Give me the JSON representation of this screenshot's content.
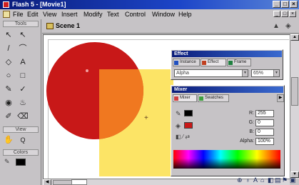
{
  "window": {
    "title": "Flash 5 - [Movie1]",
    "controls": [
      "_",
      "□",
      "×"
    ]
  },
  "menu": {
    "items": [
      "File",
      "Edit",
      "View",
      "Insert",
      "Modify",
      "Text",
      "Control",
      "Window",
      "Help"
    ],
    "doc_controls": [
      "_",
      "□",
      "×"
    ]
  },
  "toolbox": {
    "tools_label": "Tools",
    "view_label": "View",
    "colors_label": "Colors",
    "tool_glyphs": [
      "↖",
      "↖",
      "/",
      "⌒",
      "◇",
      "A",
      "○",
      "□",
      "✎",
      "✓",
      "◉",
      "♨",
      "✐",
      "⌫",
      "✋",
      "🔍"
    ]
  },
  "timeline": {
    "scene_label": "Scene 1"
  },
  "effect_panel": {
    "title": "Effect",
    "tabs": [
      "Instance",
      "Effect",
      "Frame"
    ],
    "dropdown_value": "Alpha",
    "amount_value": "65%"
  },
  "mixer_panel": {
    "title": "Mixer",
    "tabs": [
      "Mixer",
      "Swatches"
    ],
    "fields": [
      {
        "label": "R:",
        "value": "255"
      },
      {
        "label": "G:",
        "value": "0"
      },
      {
        "label": "B:",
        "value": "0"
      },
      {
        "label": "Alpha:",
        "value": "100%"
      }
    ],
    "stroke_color": "#000000",
    "fill_color": "#c81818"
  },
  "colors": {
    "circle": "#c81818",
    "square": "#fce466",
    "overlap": "#f07820"
  },
  "launcher": {
    "icons": [
      "info-icon",
      "align-icon",
      "character-icon",
      "instance-icon",
      "mixer-icon",
      "movie-explorer-icon",
      "actions-icon",
      "library-icon"
    ]
  }
}
